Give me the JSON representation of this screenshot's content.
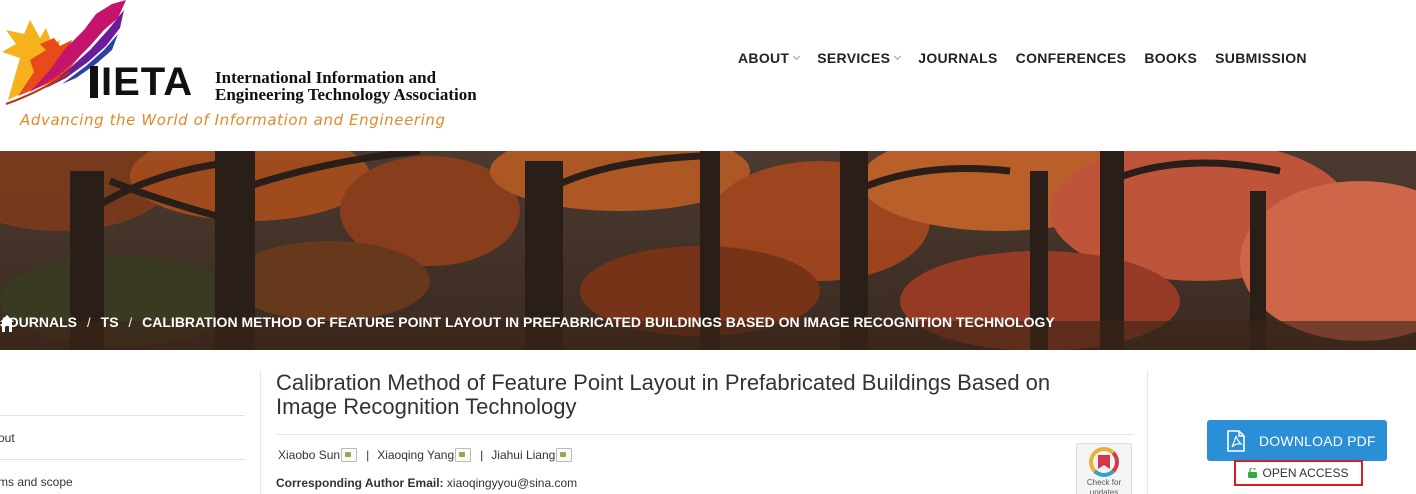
{
  "header": {
    "logo_mark": "IETA",
    "org_name_line1": "International Information and",
    "org_name_line2": "Engineering Technology Association",
    "tagline": "Advancing the World of Information and Engineering"
  },
  "nav": {
    "items": [
      {
        "label": "ABOUT",
        "dropdown": true
      },
      {
        "label": "SERVICES",
        "dropdown": true
      },
      {
        "label": "JOURNALS",
        "dropdown": false
      },
      {
        "label": "CONFERENCES",
        "dropdown": false
      },
      {
        "label": "BOOKS",
        "dropdown": false
      },
      {
        "label": "SUBMISSION",
        "dropdown": false
      }
    ]
  },
  "breadcrumb": {
    "home_icon": "home-icon",
    "items": [
      "JOURNALS",
      "TS",
      "CALIBRATION METHOD OF FEATURE POINT LAYOUT IN PREFABRICATED BUILDINGS BASED ON IMAGE RECOGNITION TECHNOLOGY"
    ],
    "separator": "/"
  },
  "sidebar": {
    "items": [
      "out",
      "ms and scope"
    ]
  },
  "article": {
    "title_line1": "Calibration Method of Feature Point Layout in Prefabricated Buildings Based on",
    "title_line2": "Image Recognition Technology",
    "authors": [
      "Xiaobo Sun",
      "Xiaoqing Yang",
      "Jiahui Liang"
    ],
    "author_separator": "|",
    "corresponding_label": "Corresponding Author Email:",
    "corresponding_email": "xiaoqingyyou@sina.com",
    "check_badge_line1": "Check for",
    "check_badge_line2": "updates"
  },
  "actions": {
    "download_pdf": "DOWNLOAD PDF",
    "open_access": "OPEN ACCESS"
  },
  "colors": {
    "primary_button": "#2a8fd6",
    "open_access_border": "#d21f1f",
    "tagline": "#e08a2a",
    "lock": "#35a845"
  }
}
